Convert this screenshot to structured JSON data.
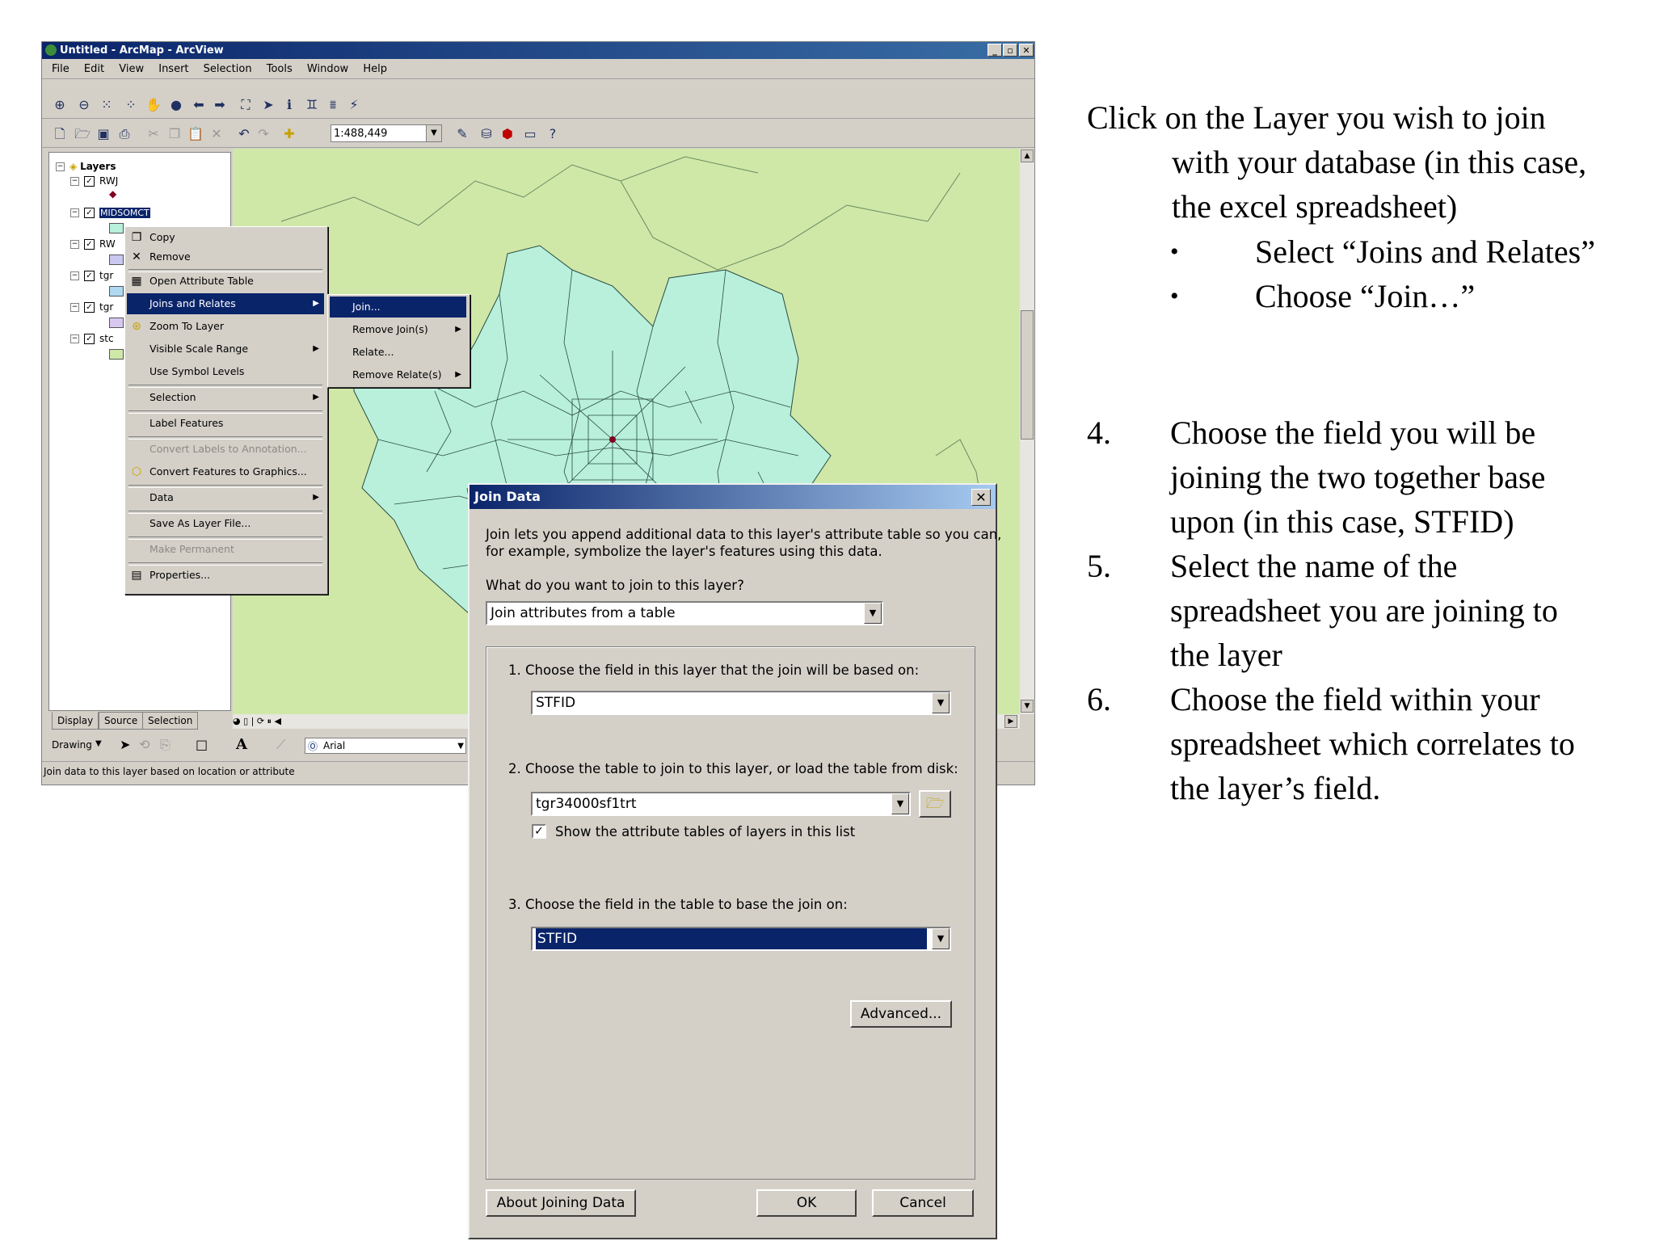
{
  "window": {
    "title": "Untitled - ArcMap - ArcView",
    "controls": [
      "_",
      "▫",
      "✕"
    ]
  },
  "menubar": [
    "File",
    "Edit",
    "View",
    "Insert",
    "Selection",
    "Tools",
    "Window",
    "Help"
  ],
  "toolbar": {
    "scale": "1:488,449"
  },
  "toc": {
    "root": "Layers",
    "layers": [
      "RWJ",
      "MIDSOMCT",
      "RW",
      "tgr",
      "tgr",
      "stc"
    ],
    "tabs": [
      "Display",
      "Source",
      "Selection"
    ]
  },
  "context_menu": {
    "items": [
      "Copy",
      "Remove",
      "Open Attribute Table",
      "Joins and Relates",
      "Zoom To Layer",
      "Visible Scale Range",
      "Use Symbol Levels",
      "Selection",
      "Label Features",
      "Convert Labels to Annotation...",
      "Convert Features to Graphics...",
      "Data",
      "Save As Layer File...",
      "Make Permanent",
      "Properties..."
    ]
  },
  "submenu": {
    "items": [
      "Join...",
      "Remove Join(s)",
      "Relate...",
      "Remove Relate(s)"
    ]
  },
  "drawbar": {
    "drawing_label": "Drawing",
    "font": "Arial"
  },
  "status": "Join data to this layer based on location or attribute",
  "dialog": {
    "title": "Join Data",
    "intro_line1": "Join lets you append additional data to this layer's attribute table so you can,",
    "intro_line2": "for example, symbolize the layer's features using this data.",
    "question": "What do you want to join to this layer?",
    "join_type": "Join attributes from a table",
    "step1_label": "1.  Choose the field in this layer that the join will be based on:",
    "step1_value": "STFID",
    "step2_label": "2.  Choose the table to join to this layer, or load the table from disk:",
    "step2_value": "tgr34000sf1trt",
    "show_layers_label": "Show the attribute tables of layers in this list",
    "step3_label": "3.  Choose the field in the table to base the join on:",
    "step3_value": "STFID",
    "advanced": "Advanced...",
    "about": "About Joining Data",
    "ok": "OK",
    "cancel": "Cancel"
  },
  "slide": {
    "intro_line1": "Click on the Layer you wish to join",
    "intro_line2": "with your database (in this case,",
    "intro_line3": "the excel spreadsheet)",
    "bullet1": "Select “Joins and Relates”",
    "bullet2": "Choose “Join…”",
    "step4_num": "4.",
    "step4_line1": "Choose the field you will be",
    "step4_line2": "joining the two together base",
    "step4_line3": "upon (in this case, STFID)",
    "step5_num": "5.",
    "step5_line1": "Select the name of the",
    "step5_line2": "spreadsheet you are joining to",
    "step5_line3": "the layer",
    "step6_num": "6.",
    "step6_line1": "Choose the field within your",
    "step6_line2": "spreadsheet which correlates to",
    "step6_line3": "the layer’s field."
  },
  "colors": {
    "titlebar": "#0a246a",
    "map_background": "#cfe8a8",
    "county_fill": "#b8f0dc",
    "menu_highlight": "#0a246a"
  }
}
